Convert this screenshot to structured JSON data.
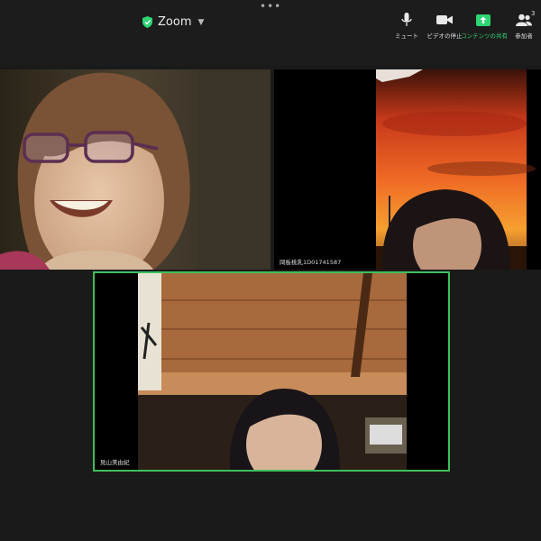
{
  "window": {
    "dots": "•••"
  },
  "meeting": {
    "title": "Zoom"
  },
  "toolbar": {
    "mute": {
      "label": "ミュート",
      "icon": "microphone-icon"
    },
    "video": {
      "label": "ビデオの停止",
      "icon": "video-camera-icon"
    },
    "share": {
      "label": "コンテンツの共有",
      "icon": "share-screen-icon"
    },
    "participants": {
      "label": "参加者",
      "icon": "participants-icon",
      "count": "3"
    }
  },
  "participants": [
    {
      "name": ""
    },
    {
      "name": "岡板桃乳1D01741587"
    },
    {
      "name": "見山美由紀"
    }
  ],
  "colors": {
    "accent_green": "#2ed573",
    "active_speaker_border": "#3fbf5a",
    "background": "#1a1a1a"
  }
}
